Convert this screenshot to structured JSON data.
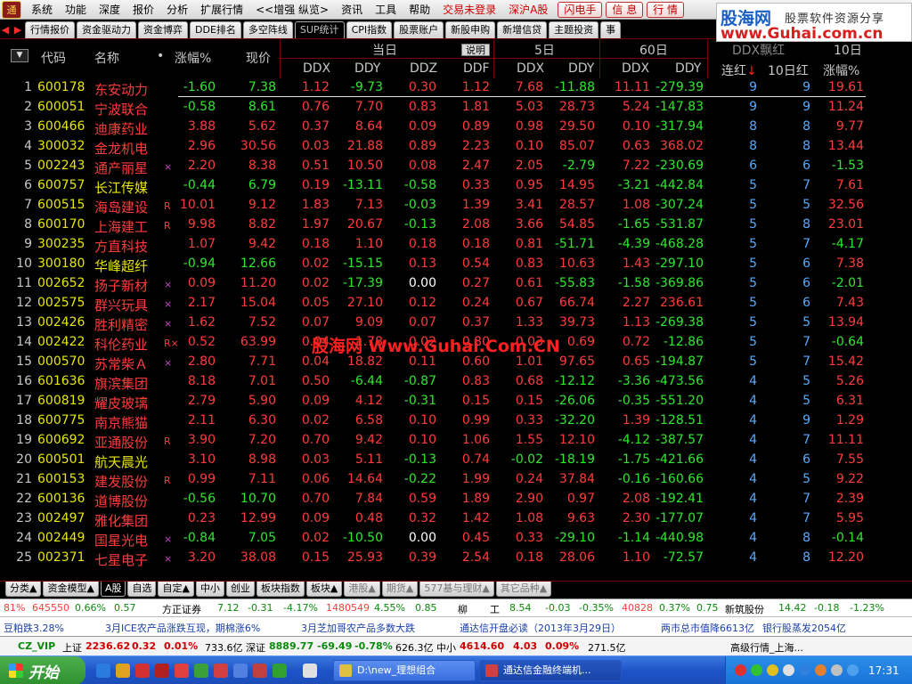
{
  "menu": {
    "items": [
      "系统",
      "功能",
      "深度",
      "报价",
      "分析",
      "扩展行情",
      "<<增强 纵览>",
      "资讯",
      "工具",
      "帮助"
    ],
    "trade_login": "交易未登录",
    "market": "深沪A股",
    "buttons": [
      "闪电手",
      "信 息",
      "行 情"
    ],
    "logo_glyph": "通"
  },
  "banner": {
    "line1": "股海网",
    "line2": "股票软件资源分享",
    "line3": "www.Guhai.com.cn"
  },
  "tabs": [
    "行情报价",
    "资金驱动力",
    "资金博弈",
    "DDE排名",
    "多空阵线",
    "SUP统计",
    "CPI指数",
    "股票账户",
    "新股申购",
    "新增信贷",
    "主题投资",
    "事"
  ],
  "active_tab": "SUP统计",
  "header": {
    "select_icon": "▼",
    "code": "代码",
    "name": "名称",
    "dot": "•",
    "pct": "涨幅%",
    "price": "现价",
    "group_today": "当日",
    "explain": "说明",
    "group_5d": "5日",
    "group_60d": "60日",
    "group_ddx": "DDX飘红",
    "consec_red": "连红",
    "arrow": "↓",
    "red10": "10日红",
    "pct2": "涨幅%",
    "col_ddx": "DDX",
    "col_ddy": "DDY",
    "col_ddz": "DDZ",
    "col_ddf": "DDF",
    "g10": "10日"
  },
  "rows": [
    {
      "i": "1",
      "code": "600178",
      "name": "东安动力",
      "flag": "",
      "pct": "-1.60",
      "price": "7.38",
      "ddx": "1.12",
      "ddy": "-9.73",
      "ddz": "0.30",
      "ddf": "1.12",
      "d5x": "7.68",
      "d5y": "-11.88",
      "d60x": "11.11",
      "d60y": "-279.39",
      "lx": "9",
      "r10": "9",
      "p2": "19.61"
    },
    {
      "i": "2",
      "code": "600051",
      "name": "宁波联合",
      "flag": "",
      "pct": "-0.58",
      "price": "8.61",
      "ddx": "0.76",
      "ddy": "7.70",
      "ddz": "0.83",
      "ddf": "1.81",
      "d5x": "5.03",
      "d5y": "28.73",
      "d60x": "5.24",
      "d60y": "-147.83",
      "lx": "9",
      "r10": "9",
      "p2": "11.24"
    },
    {
      "i": "3",
      "code": "600466",
      "name": "迪康药业",
      "flag": "",
      "pct": "3.88",
      "price": "5.62",
      "ddx": "0.37",
      "ddy": "8.64",
      "ddz": "0.09",
      "ddf": "0.89",
      "d5x": "0.98",
      "d5y": "29.50",
      "d60x": "0.10",
      "d60y": "-317.94",
      "lx": "8",
      "r10": "8",
      "p2": "9.77"
    },
    {
      "i": "4",
      "code": "300032",
      "name": "金龙机电",
      "flag": "",
      "pct": "2.96",
      "price": "30.56",
      "ddx": "0.03",
      "ddy": "21.88",
      "ddz": "0.89",
      "ddf": "2.23",
      "d5x": "0.10",
      "d5y": "85.07",
      "d60x": "0.63",
      "d60y": "368.02",
      "lx": "8",
      "r10": "8",
      "p2": "13.44"
    },
    {
      "i": "5",
      "code": "002243",
      "name": "通产丽星",
      "flag": "×",
      "pct": "2.20",
      "price": "8.38",
      "ddx": "0.51",
      "ddy": "10.50",
      "ddz": "0.08",
      "ddf": "2.47",
      "d5x": "2.05",
      "d5y": "-2.79",
      "d60x": "7.22",
      "d60y": "-230.69",
      "lx": "6",
      "r10": "6",
      "p2": "-1.53"
    },
    {
      "i": "6",
      "code": "600757",
      "name": "长江传媒",
      "flag": "",
      "pct": "-0.44",
      "price": "6.79",
      "ddx": "0.19",
      "ddy": "-13.11",
      "ddz": "-0.58",
      "ddf": "0.33",
      "d5x": "0.95",
      "d5y": "14.95",
      "d60x": "-3.21",
      "d60y": "-442.84",
      "lx": "5",
      "r10": "7",
      "p2": "7.61"
    },
    {
      "i": "7",
      "code": "600515",
      "name": "海岛建设",
      "flag": "R",
      "pct": "10.01",
      "price": "9.12",
      "ddx": "1.83",
      "ddy": "7.13",
      "ddz": "-0.03",
      "ddf": "1.39",
      "d5x": "3.41",
      "d5y": "28.57",
      "d60x": "1.08",
      "d60y": "-307.24",
      "lx": "5",
      "r10": "5",
      "p2": "32.56"
    },
    {
      "i": "8",
      "code": "600170",
      "name": "上海建工",
      "flag": "R",
      "pct": "9.98",
      "price": "8.82",
      "ddx": "1.97",
      "ddy": "20.67",
      "ddz": "-0.13",
      "ddf": "2.08",
      "d5x": "3.66",
      "d5y": "54.85",
      "d60x": "-1.65",
      "d60y": "-531.87",
      "lx": "5",
      "r10": "8",
      "p2": "23.01"
    },
    {
      "i": "9",
      "code": "300235",
      "name": "方直科技",
      "flag": "",
      "pct": "1.07",
      "price": "9.42",
      "ddx": "0.18",
      "ddy": "1.10",
      "ddz": "0.18",
      "ddf": "0.18",
      "d5x": "0.81",
      "d5y": "-51.71",
      "d60x": "-4.39",
      "d60y": "-468.28",
      "lx": "5",
      "r10": "7",
      "p2": "-4.17"
    },
    {
      "i": "10",
      "code": "300180",
      "name": "华峰超纤",
      "flag": "",
      "pct": "-0.94",
      "price": "12.66",
      "ddx": "0.02",
      "ddy": "-15.15",
      "ddz": "0.13",
      "ddf": "0.54",
      "d5x": "0.83",
      "d5y": "10.63",
      "d60x": "1.43",
      "d60y": "-297.10",
      "lx": "5",
      "r10": "6",
      "p2": "7.38"
    },
    {
      "i": "11",
      "code": "002652",
      "name": "扬子新材",
      "flag": "×",
      "pct": "0.09",
      "price": "11.20",
      "ddx": "0.02",
      "ddy": "-17.39",
      "ddz": "0.00",
      "ddf": "0.27",
      "d5x": "0.61",
      "d5y": "-55.83",
      "d60x": "-1.58",
      "d60y": "-369.86",
      "lx": "5",
      "r10": "6",
      "p2": "-2.01"
    },
    {
      "i": "12",
      "code": "002575",
      "name": "群兴玩具",
      "flag": "×",
      "pct": "2.17",
      "price": "15.04",
      "ddx": "0.05",
      "ddy": "27.10",
      "ddz": "0.12",
      "ddf": "0.24",
      "d5x": "0.67",
      "d5y": "66.74",
      "d60x": "2.27",
      "d60y": "236.61",
      "lx": "5",
      "r10": "6",
      "p2": "7.43"
    },
    {
      "i": "13",
      "code": "002426",
      "name": "胜利精密",
      "flag": "×",
      "pct": "1.62",
      "price": "7.52",
      "ddx": "0.07",
      "ddy": "9.09",
      "ddz": "0.07",
      "ddf": "0.37",
      "d5x": "1.33",
      "d5y": "39.73",
      "d60x": "1.13",
      "d60y": "-269.38",
      "lx": "5",
      "r10": "5",
      "p2": "13.94"
    },
    {
      "i": "14",
      "code": "002422",
      "name": "科伦药业",
      "flag": "R×",
      "pct": "0.52",
      "price": "63.99",
      "ddx": "0.04",
      "ddy": "1.78",
      "ddz": "0.02",
      "ddf": "0.80",
      "d5x": "0.03",
      "d5y": "0.69",
      "d60x": "0.72",
      "d60y": "-12.86",
      "lx": "5",
      "r10": "7",
      "p2": "-0.64"
    },
    {
      "i": "15",
      "code": "000570",
      "name": "苏常柴Ａ",
      "flag": "×",
      "pct": "2.80",
      "price": "7.71",
      "ddx": "0.04",
      "ddy": "18.82",
      "ddz": "0.11",
      "ddf": "0.60",
      "d5x": "1.01",
      "d5y": "97.65",
      "d60x": "0.65",
      "d60y": "-194.87",
      "lx": "5",
      "r10": "7",
      "p2": "15.42"
    },
    {
      "i": "16",
      "code": "601636",
      "name": "旗滨集团",
      "flag": "",
      "pct": "8.18",
      "price": "7.01",
      "ddx": "0.50",
      "ddy": "-6.44",
      "ddz": "-0.87",
      "ddf": "0.83",
      "d5x": "0.68",
      "d5y": "-12.12",
      "d60x": "-3.36",
      "d60y": "-473.56",
      "lx": "4",
      "r10": "5",
      "p2": "5.26"
    },
    {
      "i": "17",
      "code": "600819",
      "name": "耀皮玻璃",
      "flag": "",
      "pct": "2.79",
      "price": "5.90",
      "ddx": "0.09",
      "ddy": "4.12",
      "ddz": "-0.31",
      "ddf": "0.15",
      "d5x": "0.15",
      "d5y": "-26.06",
      "d60x": "-0.35",
      "d60y": "-551.20",
      "lx": "4",
      "r10": "5",
      "p2": "6.31"
    },
    {
      "i": "18",
      "code": "600775",
      "name": "南京熊猫",
      "flag": "",
      "pct": "2.11",
      "price": "6.30",
      "ddx": "0.02",
      "ddy": "6.58",
      "ddz": "0.10",
      "ddf": "0.99",
      "d5x": "0.33",
      "d5y": "-32.20",
      "d60x": "1.39",
      "d60y": "-128.51",
      "lx": "4",
      "r10": "9",
      "p2": "1.29"
    },
    {
      "i": "19",
      "code": "600692",
      "name": "亚通股份",
      "flag": "R",
      "pct": "3.90",
      "price": "7.20",
      "ddx": "0.70",
      "ddy": "9.42",
      "ddz": "0.10",
      "ddf": "1.06",
      "d5x": "1.55",
      "d5y": "12.10",
      "d60x": "-4.12",
      "d60y": "-387.57",
      "lx": "4",
      "r10": "7",
      "p2": "11.11"
    },
    {
      "i": "20",
      "code": "600501",
      "name": "航天晨光",
      "flag": "",
      "pct": "3.10",
      "price": "8.98",
      "ddx": "0.03",
      "ddy": "5.11",
      "ddz": "-0.13",
      "ddf": "0.74",
      "d5x": "-0.02",
      "d5y": "-18.19",
      "d60x": "-1.75",
      "d60y": "-421.66",
      "lx": "4",
      "r10": "6",
      "p2": "7.55"
    },
    {
      "i": "21",
      "code": "600153",
      "name": "建发股份",
      "flag": "R",
      "pct": "0.99",
      "price": "7.11",
      "ddx": "0.06",
      "ddy": "14.64",
      "ddz": "-0.22",
      "ddf": "1.99",
      "d5x": "0.24",
      "d5y": "37.84",
      "d60x": "-0.16",
      "d60y": "-160.66",
      "lx": "4",
      "r10": "5",
      "p2": "9.22"
    },
    {
      "i": "22",
      "code": "600136",
      "name": "道博股份",
      "flag": "",
      "pct": "-0.56",
      "price": "10.70",
      "ddx": "0.70",
      "ddy": "7.84",
      "ddz": "0.59",
      "ddf": "1.89",
      "d5x": "2.90",
      "d5y": "0.97",
      "d60x": "2.08",
      "d60y": "-192.41",
      "lx": "4",
      "r10": "7",
      "p2": "2.39"
    },
    {
      "i": "23",
      "code": "002497",
      "name": "雅化集团",
      "flag": "",
      "pct": "0.23",
      "price": "12.99",
      "ddx": "0.09",
      "ddy": "0.48",
      "ddz": "0.32",
      "ddf": "1.42",
      "d5x": "1.08",
      "d5y": "9.63",
      "d60x": "2.30",
      "d60y": "-177.07",
      "lx": "4",
      "r10": "7",
      "p2": "5.95"
    },
    {
      "i": "24",
      "code": "002449",
      "name": "国星光电",
      "flag": "×",
      "pct": "-0.84",
      "price": "7.05",
      "ddx": "0.02",
      "ddy": "-10.50",
      "ddz": "0.00",
      "ddf": "0.45",
      "d5x": "0.33",
      "d5y": "-29.10",
      "d60x": "-1.14",
      "d60y": "-440.98",
      "lx": "4",
      "r10": "8",
      "p2": "-0.14"
    },
    {
      "i": "25",
      "code": "002371",
      "name": "七星电子",
      "flag": "×",
      "pct": "3.20",
      "price": "38.08",
      "ddx": "0.15",
      "ddy": "25.93",
      "ddz": "0.39",
      "ddf": "2.54",
      "d5x": "0.18",
      "d5y": "28.06",
      "d60x": "1.10",
      "d60y": "-72.57",
      "lx": "4",
      "r10": "8",
      "p2": "12.20"
    }
  ],
  "watermark": "股海网 Www.Guhai.Com.CN",
  "bottom_tabs": [
    {
      "label": "分类▲",
      "active": false,
      "dim": false
    },
    {
      "label": "资金模型▲",
      "active": false,
      "dim": false
    },
    {
      "label": "A股",
      "active": true,
      "dim": false
    },
    {
      "label": "自选",
      "active": false,
      "dim": false
    },
    {
      "label": "自定▲",
      "active": false,
      "dim": false
    },
    {
      "label": "中小",
      "active": false,
      "dim": false
    },
    {
      "label": "创业",
      "active": false,
      "dim": false
    },
    {
      "label": "板块指数",
      "active": false,
      "dim": false
    },
    {
      "label": "板块▲",
      "active": false,
      "dim": false
    },
    {
      "label": "港股▲",
      "active": false,
      "dim": true
    },
    {
      "label": "期货▲",
      "active": false,
      "dim": true
    },
    {
      "label": "577基与理财▲",
      "active": false,
      "dim": true
    },
    {
      "label": "其它品种▲",
      "active": false,
      "dim": true
    }
  ],
  "ticker1": {
    "a": "81%",
    "b": "645550",
    "c": "0.66%",
    "d": "0.57",
    "e": "方正证券",
    "f": "7.12",
    "g": "-0.31",
    "h": "-4.17%",
    "i": "1480549",
    "j": "4.55%",
    "k": "0.85",
    "l": "柳",
    "m": "工",
    "n": "8.54",
    "o": "-0.03",
    "p": "-0.35%",
    "q": "40828",
    "r": "0.37%",
    "s": "0.75",
    "t": "新筑股份",
    "u": "14.42",
    "v": "-0.18",
    "w": "-1.23%"
  },
  "ticker2": {
    "a": "豆粕跌3.28%",
    "b": "3月ICE农产品涨跌互现，期棉涨6%",
    "c": "3月芝加哥农产品多数大跌",
    "d": "通达信开盘必读（2013年3月29日）",
    "e": "两市总市值降6613亿",
    "f": "银行股蒸发2054亿"
  },
  "status": {
    "vip": "CZ_VIP",
    "sh_label": "上证",
    "sh_val": "2236.62",
    "sh_chg": "0.32",
    "sh_pct": "0.01%",
    "sh_amt": "733.6亿",
    "sz_label": "深证",
    "sz_val": "8889.77",
    "sz_chg": "-69.49",
    "sz_pct": "-0.78%",
    "sz_amt": "626.3亿",
    "zx_label": "中小",
    "zx_val": "4614.60",
    "zx_chg": "4.03",
    "zx_pct": "0.09%",
    "zx_amt": "271.5亿",
    "right": "高级行情_上海..."
  },
  "taskbar": {
    "start": "开始",
    "task1": "D:\\new_理想组合",
    "task2": "通达信金融终端机...",
    "clock": "17:31"
  },
  "colors": {
    "up": "#ff3c3c",
    "down": "#2ee82e",
    "code": "#e6e60a",
    "count": "#56aaff",
    "grid": "#7a0000"
  }
}
